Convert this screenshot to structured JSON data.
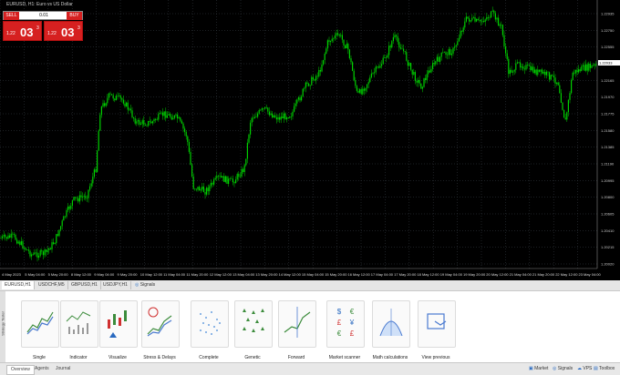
{
  "chart": {
    "title": "EURUSD, H1: Euro vs US Dollar",
    "trade_panel": {
      "sell_label": "SELL",
      "buy_label": "BUY",
      "lot": "0.01",
      "sell_small": "1.22",
      "sell_big": "03",
      "sell_sup": "3",
      "buy_small": "1.22",
      "buy_big": "03",
      "buy_sup": "3"
    },
    "y_ticks": [
      "1.22935",
      "1.22750",
      "1.22555",
      "1.22360",
      "1.22165",
      "1.21970",
      "1.21775",
      "1.21580",
      "1.21385",
      "1.21190",
      "1.20995",
      "1.20800",
      "1.20605",
      "1.20410",
      "1.20215",
      "1.20020"
    ],
    "current_price": "1.22033",
    "x_ticks": [
      "4 May 2023",
      "5 May 04:00",
      "5 May 20:00",
      "8 May 12:00",
      "9 May 04:00",
      "9 May 20:00",
      "10 May 12:00",
      "11 May 04:00",
      "11 May 20:00",
      "12 May 12:00",
      "13 May 04:00",
      "13 May 20:00",
      "14 May 12:00",
      "15 May 04:00",
      "15 May 20:00",
      "16 May 12:00",
      "17 May 04:00",
      "17 May 20:00",
      "18 May 12:00",
      "19 May 04:00",
      "19 May 20:00",
      "20 May 12:00",
      "21 May 04:00",
      "21 May 20:00",
      "22 May 12:00",
      "23 May 04:00"
    ]
  },
  "symbol_tabs": [
    {
      "label": "EURUSD,H1",
      "active": true
    },
    {
      "label": "USDCHF,M5",
      "active": false
    },
    {
      "label": "GBPUSD,H1",
      "active": false
    },
    {
      "label": "USDJPY,H1",
      "active": false
    },
    {
      "label": "Signals",
      "active": false
    }
  ],
  "side_label": "Strategy Tester",
  "tiles": [
    {
      "label": "Single",
      "icon": "single-test-icon"
    },
    {
      "label": "Indicator",
      "icon": "indicator-icon"
    },
    {
      "label": "Visualize",
      "icon": "visualize-icon"
    },
    {
      "label": "Stress & Delays",
      "icon": "stress-delays-icon"
    },
    {
      "label": "Complete",
      "icon": "complete-icon"
    },
    {
      "label": "Genetic",
      "icon": "genetic-icon"
    },
    {
      "label": "Forward",
      "icon": "forward-icon"
    },
    {
      "label": "Market scanner",
      "icon": "market-scanner-icon"
    },
    {
      "label": "Math calculations",
      "icon": "math-calculations-icon"
    },
    {
      "label": "View previous",
      "icon": "view-previous-icon"
    }
  ],
  "scanner_symbols": [
    "$",
    "€",
    "£",
    "¥",
    "€",
    "£"
  ],
  "bottom_tabs": [
    {
      "label": "Overview",
      "active": true
    },
    {
      "label": "Agents",
      "active": false
    },
    {
      "label": "Journal",
      "active": false
    }
  ],
  "right_links": [
    {
      "label": "Market",
      "icon": "market-icon"
    },
    {
      "label": "Signals",
      "icon": "signals-icon"
    },
    {
      "label": "VPS",
      "icon": "vps-icon"
    },
    {
      "label": "Toolbox",
      "icon": "toolbox-icon"
    }
  ],
  "colors": {
    "candle": "#00d000",
    "sell": "#d62020",
    "background": "#000000",
    "grid": "#5a6470"
  }
}
